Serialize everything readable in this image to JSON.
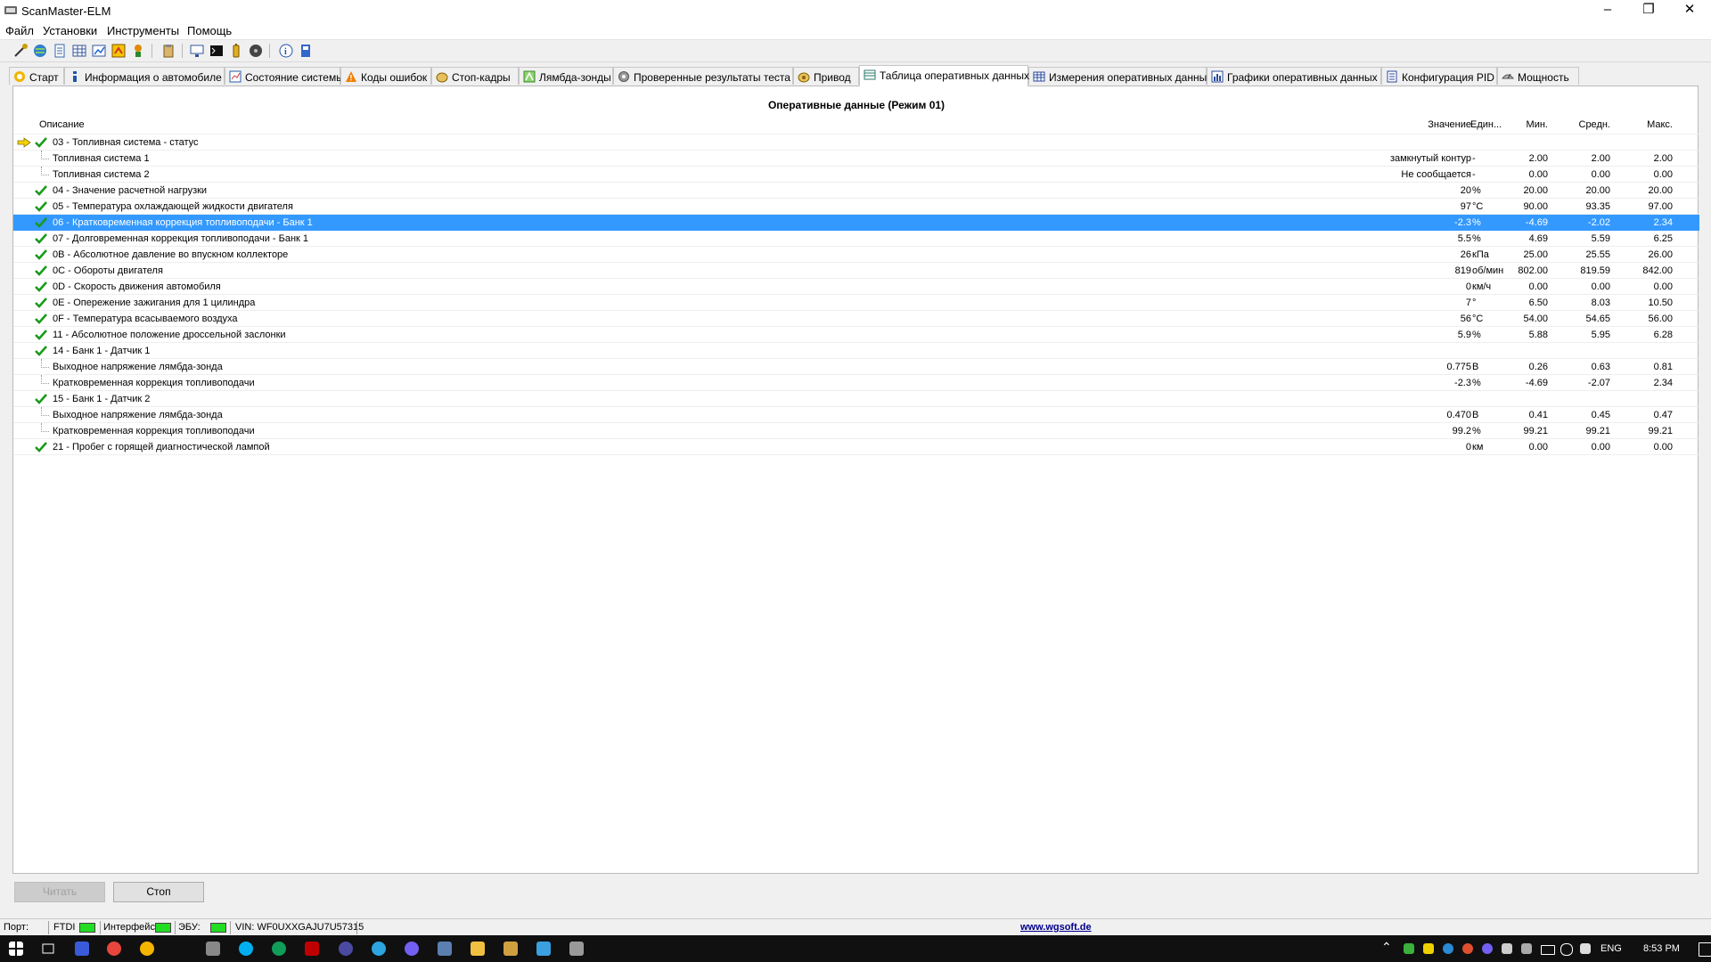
{
  "window": {
    "title": "ScanMaster-ELM"
  },
  "menu": [
    "Файл",
    "Установки",
    "Инструменты",
    "Помощь"
  ],
  "tabs": [
    {
      "label": "Старт",
      "icon": "start-icon"
    },
    {
      "label": "Информация о автомобиле",
      "icon": "info-icon"
    },
    {
      "label": "Состояние системы",
      "icon": "system-status-icon"
    },
    {
      "label": "Коды ошибок",
      "icon": "warning-icon"
    },
    {
      "label": "Стоп-кадры",
      "icon": "freeze-frame-icon"
    },
    {
      "label": "Лямбда-зонды",
      "icon": "lambda-sensor-icon"
    },
    {
      "label": "Проверенные результаты теста",
      "icon": "gear-icon"
    },
    {
      "label": "Привод",
      "icon": "actuator-icon"
    },
    {
      "label": "Таблица оперативных данных",
      "icon": "table-icon"
    },
    {
      "label": "Измерения оперативных данных",
      "icon": "measurement-icon"
    },
    {
      "label": "Графики оперативных данных",
      "icon": "chart-icon"
    },
    {
      "label": "Конфигурация PID",
      "icon": "pid-config-icon"
    },
    {
      "label": "Мощность",
      "icon": "power-icon"
    }
  ],
  "active_tab": "Таблица оперативных данных",
  "grid": {
    "title": "Оперативные данные (Режим 01)",
    "headers": {
      "desc": "Описание",
      "value": "Значение",
      "unit": "Един...",
      "min": "Мин.",
      "avg": "Средн.",
      "max": "Макс."
    },
    "rows": [
      {
        "desc": "03 - Топливная система - статус",
        "value": "",
        "unit": "",
        "min": "",
        "avg": "",
        "max": "",
        "checked": true,
        "arrow": true,
        "child": false
      },
      {
        "desc": "Топливная система 1",
        "value": "замкнутый контур",
        "unit": "-",
        "min": "2.00",
        "avg": "2.00",
        "max": "2.00",
        "checked": false,
        "child": true
      },
      {
        "desc": "Топливная система 2",
        "value": "Не сообщается",
        "unit": "-",
        "min": "0.00",
        "avg": "0.00",
        "max": "0.00",
        "checked": false,
        "child": true
      },
      {
        "desc": "04 - Значение расчетной нагрузки",
        "value": "20",
        "unit": "%",
        "min": "20.00",
        "avg": "20.00",
        "max": "20.00",
        "checked": true,
        "child": false
      },
      {
        "desc": "05 - Температура охлаждающей жидкости двигателя",
        "value": "97",
        "unit": "°C",
        "min": "90.00",
        "avg": "93.35",
        "max": "97.00",
        "checked": true,
        "child": false
      },
      {
        "desc": "06 - Кратковременная коррекция топливоподачи - Банк 1",
        "value": "-2.3",
        "unit": "%",
        "min": "-4.69",
        "avg": "-2.02",
        "max": "2.34",
        "checked": true,
        "child": false,
        "selected": true
      },
      {
        "desc": "07 - Долговременная коррекция топливоподачи - Банк 1",
        "value": "5.5",
        "unit": "%",
        "min": "4.69",
        "avg": "5.59",
        "max": "6.25",
        "checked": true,
        "child": false
      },
      {
        "desc": "0B - Абсолютное давление во впускном коллекторе",
        "value": "26",
        "unit": "кПа",
        "min": "25.00",
        "avg": "25.55",
        "max": "26.00",
        "checked": true,
        "child": false
      },
      {
        "desc": "0C - Обороты двигателя",
        "value": "819",
        "unit": "об/мин",
        "min": "802.00",
        "avg": "819.59",
        "max": "842.00",
        "checked": true,
        "child": false
      },
      {
        "desc": "0D - Скорость движения автомобиля",
        "value": "0",
        "unit": "км/ч",
        "min": "0.00",
        "avg": "0.00",
        "max": "0.00",
        "checked": true,
        "child": false
      },
      {
        "desc": "0E - Опережение зажигания для 1 цилиндра",
        "value": "7",
        "unit": "°",
        "min": "6.50",
        "avg": "8.03",
        "max": "10.50",
        "checked": true,
        "child": false
      },
      {
        "desc": "0F - Температура всасываемого воздуха",
        "value": "56",
        "unit": "°C",
        "min": "54.00",
        "avg": "54.65",
        "max": "56.00",
        "checked": true,
        "child": false
      },
      {
        "desc": "11 - Абсолютное положение дроссельной заслонки",
        "value": "5.9",
        "unit": "%",
        "min": "5.88",
        "avg": "5.95",
        "max": "6.28",
        "checked": true,
        "child": false
      },
      {
        "desc": "14 - Банк 1 - Датчик 1",
        "value": "",
        "unit": "",
        "min": "",
        "avg": "",
        "max": "",
        "checked": true,
        "child": false
      },
      {
        "desc": "Выходное напряжение лямбда-зонда",
        "value": "0.775",
        "unit": "В",
        "min": "0.26",
        "avg": "0.63",
        "max": "0.81",
        "checked": false,
        "child": true
      },
      {
        "desc": "Кратковременная коррекция топливоподачи",
        "value": "-2.3",
        "unit": "%",
        "min": "-4.69",
        "avg": "-2.07",
        "max": "2.34",
        "checked": false,
        "child": true
      },
      {
        "desc": "15 - Банк 1 - Датчик 2",
        "value": "",
        "unit": "",
        "min": "",
        "avg": "",
        "max": "",
        "checked": true,
        "child": false
      },
      {
        "desc": "Выходное напряжение лямбда-зонда",
        "value": "0.470",
        "unit": "В",
        "min": "0.41",
        "avg": "0.45",
        "max": "0.47",
        "checked": false,
        "child": true
      },
      {
        "desc": "Кратковременная коррекция топливоподачи",
        "value": "99.2",
        "unit": "%",
        "min": "99.21",
        "avg": "99.21",
        "max": "99.21",
        "checked": false,
        "child": true
      },
      {
        "desc": "21 - Пробег с горящей диагностической лампой",
        "value": "0",
        "unit": "км",
        "min": "0.00",
        "avg": "0.00",
        "max": "0.00",
        "checked": true,
        "child": false
      }
    ]
  },
  "buttons": {
    "read": "Читать",
    "stop": "Стоп"
  },
  "status": {
    "port_label": "Порт:",
    "ftdi_label": "FTDI",
    "interface_label": "Интерфейс:",
    "ecu_label": "ЭБУ:",
    "vin": "VIN: WF0UXXGAJU7U57315",
    "link": "www.wgsoft.de"
  },
  "taskbar": {
    "lang": "ENG",
    "time": "8:53 PM"
  },
  "colors": {
    "selection": "#3399ff",
    "check": "#1a9a1a",
    "led": "#22dd22",
    "link": "#00008b"
  }
}
